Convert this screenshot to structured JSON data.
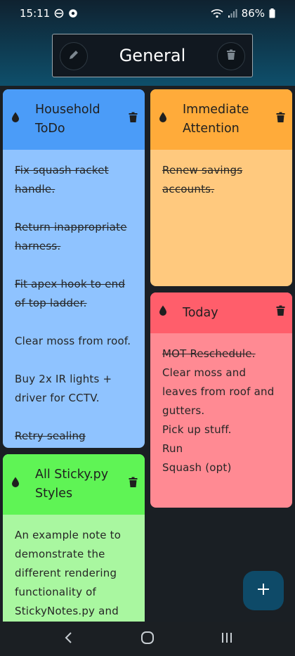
{
  "status": {
    "time": "15:11",
    "battery": "86%"
  },
  "header": {
    "title": "General"
  },
  "notes": [
    {
      "title_lines": [
        "Household",
        "ToDo"
      ],
      "items": [
        {
          "text": "Fix squash racket",
          "struck": true
        },
        {
          "text": "handle.",
          "struck": true
        },
        {
          "gap": true
        },
        {
          "text": "Return inappropriate",
          "struck": true
        },
        {
          "text": "harness.",
          "struck": true
        },
        {
          "gap": true
        },
        {
          "text": "Fit apex hook to end",
          "struck": true
        },
        {
          "text": "of top ladder.",
          "struck": true
        },
        {
          "gap": true
        },
        {
          "text": "Clear moss from roof.",
          "struck": false
        },
        {
          "gap": true
        },
        {
          "text": "Buy 2x IR lights +",
          "struck": false
        },
        {
          "text": "driver for CCTV.",
          "struck": false
        },
        {
          "gap": true
        },
        {
          "text": "Retry sealing exhaust.",
          "struck": true
        }
      ]
    },
    {
      "title_lines": [
        "Immediate",
        "Attention"
      ],
      "items": [
        {
          "text": "Renew savings",
          "struck": true
        },
        {
          "text": "accounts.",
          "struck": true
        }
      ]
    },
    {
      "title_lines": [
        "Today"
      ],
      "items": [
        {
          "text": "MOT Reschedule.",
          "struck": true
        },
        {
          "text": "Clear moss and",
          "struck": false
        },
        {
          "text": "leaves from roof and",
          "struck": false
        },
        {
          "text": "gutters.",
          "struck": false
        },
        {
          "text": "Pick up stuff.",
          "struck": false
        },
        {
          "text": "Run",
          "struck": false
        },
        {
          "text": "Squash (opt)",
          "struck": false
        }
      ]
    },
    {
      "title_lines": [
        "All Sticky.py",
        "Styles"
      ],
      "items": [
        {
          "text": "An example note to",
          "struck": false
        },
        {
          "text": "demonstrate the",
          "struck": false
        },
        {
          "text": "different rendering",
          "struck": false
        },
        {
          "text": "functionality of",
          "struck": false
        },
        {
          "text": "StickyNotes.py and",
          "struck": false
        }
      ]
    }
  ],
  "icons": {
    "edit": "pencil-icon",
    "delete": "trash-icon",
    "color": "drop-icon",
    "add": "plus-icon",
    "nav_back": "back-chevron-icon",
    "nav_home": "home-circle-icon",
    "nav_recents": "recents-icon"
  },
  "colors": {
    "blue_head": "#4b9cf8",
    "blue_body": "#8fc3ff",
    "orange_head": "#ffab3a",
    "orange_body": "#ffc97e",
    "red_head": "#ff5e6b",
    "red_body": "#ff8a93",
    "green_head": "#5ff455",
    "green_body": "#a9f7a0",
    "fab": "#0e4a68"
  }
}
